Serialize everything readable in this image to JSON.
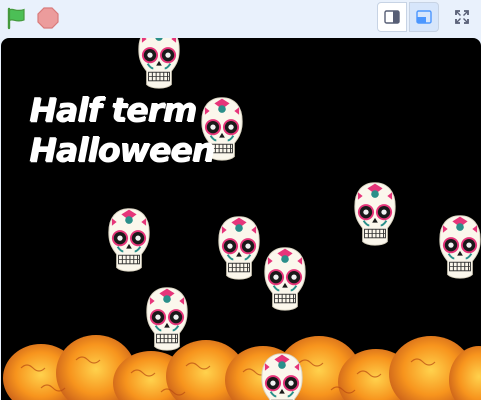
{
  "toolbar": {
    "green_flag_icon": "green-flag-icon",
    "stop_icon": "stop-sign-icon",
    "small_stage_icon": "small-stage-icon",
    "large_stage_icon": "large-stage-icon",
    "fullscreen_icon": "fullscreen-icon"
  },
  "stage": {
    "title_line1": "Half term",
    "title_line2": "Halloween"
  },
  "colors": {
    "toolbar_bg": "#e9f1fc",
    "flag_green": "#4cbf56",
    "stop_red": "#ec9c9c",
    "stage_bg": "#000000",
    "marigold": "#f7941d"
  }
}
